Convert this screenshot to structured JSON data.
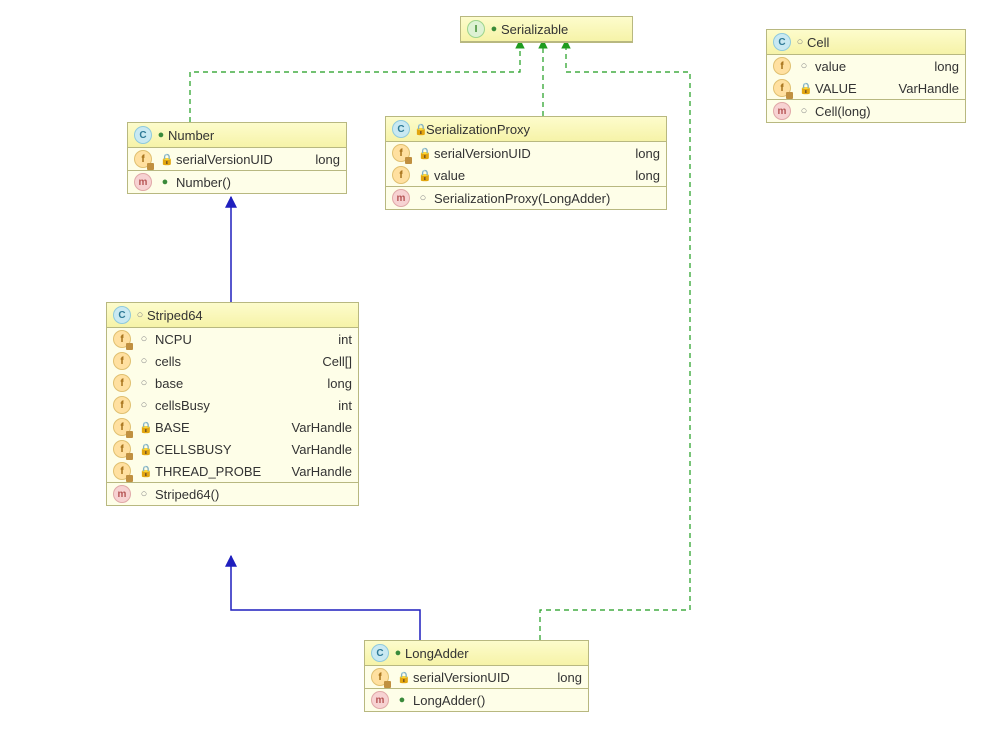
{
  "boxes": {
    "serializable": {
      "title": "Serializable",
      "kind": "interface"
    },
    "cell": {
      "title": "Cell",
      "fields": [
        {
          "name": "value",
          "type": "long",
          "vis": "pkg",
          "static": false
        },
        {
          "name": "VALUE",
          "type": "VarHandle",
          "vis": "priv",
          "static": true
        }
      ],
      "methods": [
        {
          "sig": "Cell(long)",
          "vis": "pkg"
        }
      ]
    },
    "number": {
      "title": "Number",
      "fields": [
        {
          "name": "serialVersionUID",
          "type": "long",
          "vis": "priv",
          "static": true
        }
      ],
      "methods": [
        {
          "sig": "Number()",
          "vis": "pub"
        }
      ]
    },
    "serializationProxy": {
      "title": "SerializationProxy",
      "fields": [
        {
          "name": "serialVersionUID",
          "type": "long",
          "vis": "priv",
          "static": true
        },
        {
          "name": "value",
          "type": "long",
          "vis": "priv",
          "static": false
        }
      ],
      "methods": [
        {
          "sig": "SerializationProxy(LongAdder)",
          "vis": "pkg"
        }
      ]
    },
    "striped64": {
      "title": "Striped64",
      "fields": [
        {
          "name": "NCPU",
          "type": "int",
          "vis": "pkg",
          "static": true
        },
        {
          "name": "cells",
          "type": "Cell[]",
          "vis": "pkg",
          "static": false
        },
        {
          "name": "base",
          "type": "long",
          "vis": "pkg",
          "static": false
        },
        {
          "name": "cellsBusy",
          "type": "int",
          "vis": "pkg",
          "static": false
        },
        {
          "name": "BASE",
          "type": "VarHandle",
          "vis": "priv",
          "static": true
        },
        {
          "name": "CELLSBUSY",
          "type": "VarHandle",
          "vis": "priv",
          "static": true
        },
        {
          "name": "THREAD_PROBE",
          "type": "VarHandle",
          "vis": "priv",
          "static": true
        }
      ],
      "methods": [
        {
          "sig": "Striped64()",
          "vis": "pkg"
        }
      ]
    },
    "longAdder": {
      "title": "LongAdder",
      "fields": [
        {
          "name": "serialVersionUID",
          "type": "long",
          "vis": "priv",
          "static": true
        }
      ],
      "methods": [
        {
          "sig": "LongAdder()",
          "vis": "pub"
        }
      ]
    }
  },
  "colors": {
    "extends": "#1f1fbe",
    "implements": "#1f9c1f"
  }
}
